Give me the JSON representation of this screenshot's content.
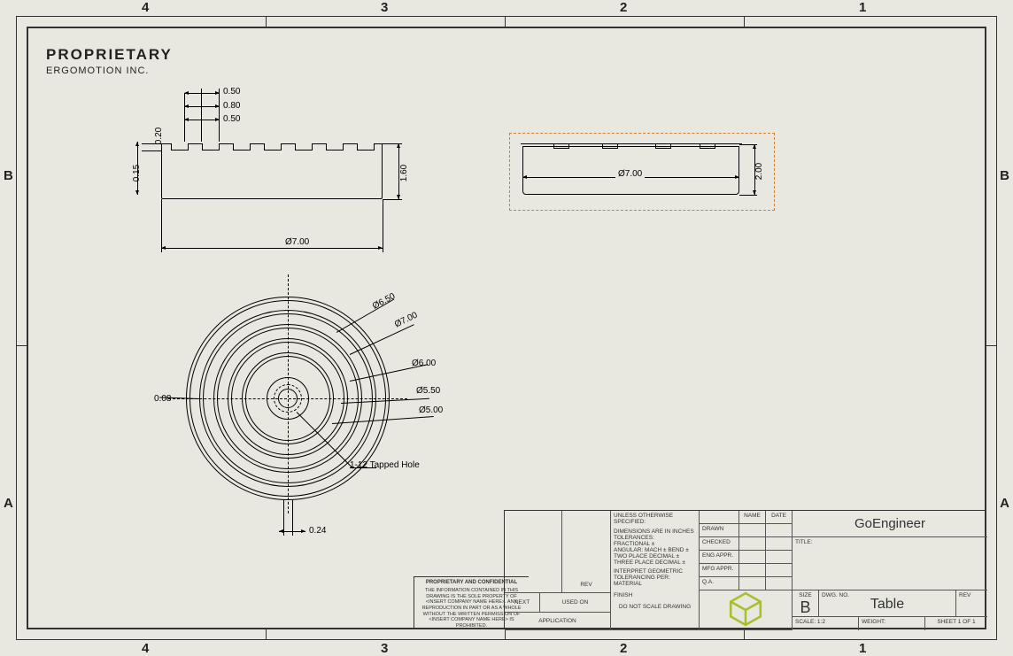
{
  "proprietary": {
    "title": "PROPRIETARY",
    "company": "ERGOMOTION INC."
  },
  "zones": {
    "cols": [
      "4",
      "3",
      "2",
      "1"
    ],
    "rows": [
      "B",
      "A"
    ]
  },
  "section_view": {
    "dims": {
      "d050a": "0.50",
      "d080": "0.80",
      "d050b": "0.50",
      "d020": "0.20",
      "d015": "0.15",
      "h160": "1.60",
      "dia7": "Ø7.00"
    }
  },
  "side_view": {
    "dia7": "Ø7.00",
    "h2": "2.00"
  },
  "plan_view": {
    "dias": [
      "Ø6.50",
      "Ø7.00",
      "Ø6.00",
      "Ø5.50",
      "Ø5.00"
    ],
    "d008": "0.08",
    "d024": "0.24",
    "note": "1-12 Tapped Hole"
  },
  "title_block": {
    "unless": "UNLESS OTHERWISE SPECIFIED:",
    "dim_in": "DIMENSIONS ARE IN INCHES",
    "tol": "TOLERANCES:",
    "fractional": "FRACTIONAL ±",
    "angular": "ANGULAR: MACH ±    BEND ±",
    "two_place": "TWO PLACE DECIMAL   ±",
    "three_place": "THREE PLACE DECIMAL ±",
    "interpret": "INTERPRET GEOMETRIC",
    "tol_per": "TOLERANCING PER:",
    "material": "MATERIAL",
    "finish": "FINISH",
    "dns": "DO NOT SCALE DRAWING",
    "next_assy": "NEXT ASSY",
    "used_on": "USED ON",
    "application": "APPLICATION",
    "rev_hdr": "REV",
    "name": "NAME",
    "date": "DATE",
    "drawn": "DRAWN",
    "checked": "CHECKED",
    "eng": "ENG APPR.",
    "mfg": "MFG APPR.",
    "qa": "Q.A.",
    "company": "GoEngineer",
    "title_lbl": "TITLE:",
    "size_lbl": "SIZE",
    "size": "B",
    "dwgno_lbl": "DWG. NO.",
    "dwgno": "Table",
    "rev_lbl": "REV",
    "scale_lbl": "SCALE: 1:2",
    "weight_lbl": "WEIGHT:",
    "sheet": "SHEET 1 OF 1"
  },
  "confidential": {
    "title": "PROPRIETARY AND CONFIDENTIAL",
    "body": "THE INFORMATION CONTAINED IN THIS DRAWING IS THE SOLE PROPERTY OF <INSERT COMPANY NAME HERE>. ANY REPRODUCTION IN PART OR AS A WHOLE WITHOUT THE WRITTEN PERMISSION OF <INSERT COMPANY NAME HERE> IS PROHIBITED."
  }
}
